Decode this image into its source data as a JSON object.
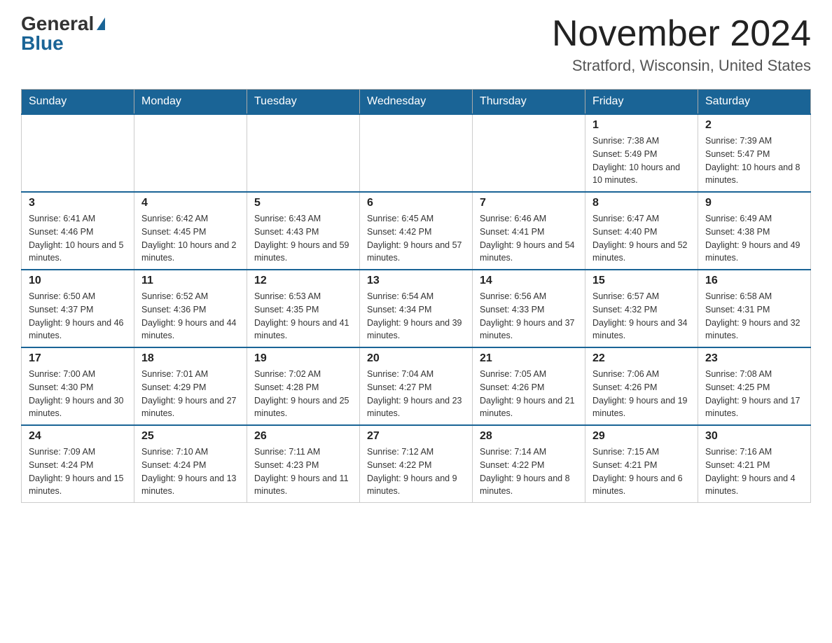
{
  "header": {
    "logo_general": "General",
    "logo_blue": "Blue",
    "month_title": "November 2024",
    "location": "Stratford, Wisconsin, United States"
  },
  "days_of_week": [
    "Sunday",
    "Monday",
    "Tuesday",
    "Wednesday",
    "Thursday",
    "Friday",
    "Saturday"
  ],
  "weeks": [
    [
      {
        "day": "",
        "info": ""
      },
      {
        "day": "",
        "info": ""
      },
      {
        "day": "",
        "info": ""
      },
      {
        "day": "",
        "info": ""
      },
      {
        "day": "",
        "info": ""
      },
      {
        "day": "1",
        "info": "Sunrise: 7:38 AM\nSunset: 5:49 PM\nDaylight: 10 hours and 10 minutes."
      },
      {
        "day": "2",
        "info": "Sunrise: 7:39 AM\nSunset: 5:47 PM\nDaylight: 10 hours and 8 minutes."
      }
    ],
    [
      {
        "day": "3",
        "info": "Sunrise: 6:41 AM\nSunset: 4:46 PM\nDaylight: 10 hours and 5 minutes."
      },
      {
        "day": "4",
        "info": "Sunrise: 6:42 AM\nSunset: 4:45 PM\nDaylight: 10 hours and 2 minutes."
      },
      {
        "day": "5",
        "info": "Sunrise: 6:43 AM\nSunset: 4:43 PM\nDaylight: 9 hours and 59 minutes."
      },
      {
        "day": "6",
        "info": "Sunrise: 6:45 AM\nSunset: 4:42 PM\nDaylight: 9 hours and 57 minutes."
      },
      {
        "day": "7",
        "info": "Sunrise: 6:46 AM\nSunset: 4:41 PM\nDaylight: 9 hours and 54 minutes."
      },
      {
        "day": "8",
        "info": "Sunrise: 6:47 AM\nSunset: 4:40 PM\nDaylight: 9 hours and 52 minutes."
      },
      {
        "day": "9",
        "info": "Sunrise: 6:49 AM\nSunset: 4:38 PM\nDaylight: 9 hours and 49 minutes."
      }
    ],
    [
      {
        "day": "10",
        "info": "Sunrise: 6:50 AM\nSunset: 4:37 PM\nDaylight: 9 hours and 46 minutes."
      },
      {
        "day": "11",
        "info": "Sunrise: 6:52 AM\nSunset: 4:36 PM\nDaylight: 9 hours and 44 minutes."
      },
      {
        "day": "12",
        "info": "Sunrise: 6:53 AM\nSunset: 4:35 PM\nDaylight: 9 hours and 41 minutes."
      },
      {
        "day": "13",
        "info": "Sunrise: 6:54 AM\nSunset: 4:34 PM\nDaylight: 9 hours and 39 minutes."
      },
      {
        "day": "14",
        "info": "Sunrise: 6:56 AM\nSunset: 4:33 PM\nDaylight: 9 hours and 37 minutes."
      },
      {
        "day": "15",
        "info": "Sunrise: 6:57 AM\nSunset: 4:32 PM\nDaylight: 9 hours and 34 minutes."
      },
      {
        "day": "16",
        "info": "Sunrise: 6:58 AM\nSunset: 4:31 PM\nDaylight: 9 hours and 32 minutes."
      }
    ],
    [
      {
        "day": "17",
        "info": "Sunrise: 7:00 AM\nSunset: 4:30 PM\nDaylight: 9 hours and 30 minutes."
      },
      {
        "day": "18",
        "info": "Sunrise: 7:01 AM\nSunset: 4:29 PM\nDaylight: 9 hours and 27 minutes."
      },
      {
        "day": "19",
        "info": "Sunrise: 7:02 AM\nSunset: 4:28 PM\nDaylight: 9 hours and 25 minutes."
      },
      {
        "day": "20",
        "info": "Sunrise: 7:04 AM\nSunset: 4:27 PM\nDaylight: 9 hours and 23 minutes."
      },
      {
        "day": "21",
        "info": "Sunrise: 7:05 AM\nSunset: 4:26 PM\nDaylight: 9 hours and 21 minutes."
      },
      {
        "day": "22",
        "info": "Sunrise: 7:06 AM\nSunset: 4:26 PM\nDaylight: 9 hours and 19 minutes."
      },
      {
        "day": "23",
        "info": "Sunrise: 7:08 AM\nSunset: 4:25 PM\nDaylight: 9 hours and 17 minutes."
      }
    ],
    [
      {
        "day": "24",
        "info": "Sunrise: 7:09 AM\nSunset: 4:24 PM\nDaylight: 9 hours and 15 minutes."
      },
      {
        "day": "25",
        "info": "Sunrise: 7:10 AM\nSunset: 4:24 PM\nDaylight: 9 hours and 13 minutes."
      },
      {
        "day": "26",
        "info": "Sunrise: 7:11 AM\nSunset: 4:23 PM\nDaylight: 9 hours and 11 minutes."
      },
      {
        "day": "27",
        "info": "Sunrise: 7:12 AM\nSunset: 4:22 PM\nDaylight: 9 hours and 9 minutes."
      },
      {
        "day": "28",
        "info": "Sunrise: 7:14 AM\nSunset: 4:22 PM\nDaylight: 9 hours and 8 minutes."
      },
      {
        "day": "29",
        "info": "Sunrise: 7:15 AM\nSunset: 4:21 PM\nDaylight: 9 hours and 6 minutes."
      },
      {
        "day": "30",
        "info": "Sunrise: 7:16 AM\nSunset: 4:21 PM\nDaylight: 9 hours and 4 minutes."
      }
    ]
  ]
}
